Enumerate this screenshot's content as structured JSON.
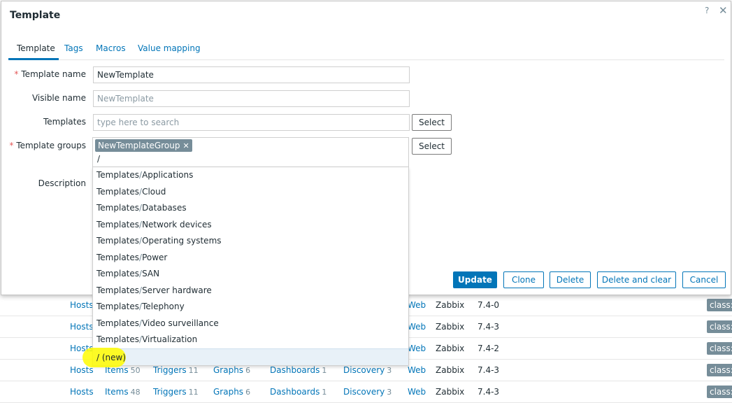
{
  "background_rows": [
    {
      "hosts": "Hosts",
      "items": "",
      "items_count": "",
      "triggers": "",
      "triggers_count": "",
      "graphs": "",
      "graphs_count": "",
      "dashboards": "",
      "dashboards_count": "",
      "discovery": "",
      "discovery_count": "",
      "web": "Web",
      "vendor": "Zabbix",
      "version": "7.4-0",
      "tag": "class:"
    },
    {
      "hosts": "Hosts",
      "items": "",
      "items_count": "",
      "triggers": "",
      "triggers_count": "",
      "graphs": "",
      "graphs_count": "",
      "dashboards": "",
      "dashboards_count": "",
      "discovery": "",
      "discovery_count": "",
      "web": "Web",
      "vendor": "Zabbix",
      "version": "7.4-3",
      "tag": "class:"
    },
    {
      "hosts": "Hosts",
      "items": "",
      "items_count": "",
      "triggers": "",
      "triggers_count": "",
      "graphs": "",
      "graphs_count": "",
      "dashboards": "",
      "dashboards_count": "",
      "discovery": "",
      "discovery_count": "",
      "web": "Web",
      "vendor": "Zabbix",
      "version": "7.4-2",
      "tag": "class:"
    },
    {
      "hosts": "Hosts",
      "items": "Items",
      "items_count": "50",
      "triggers": "Triggers",
      "triggers_count": "11",
      "graphs": "Graphs",
      "graphs_count": "6",
      "dashboards": "Dashboards",
      "dashboards_count": "1",
      "discovery": "Discovery",
      "discovery_count": "3",
      "web": "Web",
      "vendor": "Zabbix",
      "version": "7.4-3",
      "tag": "class:"
    },
    {
      "hosts": "Hosts",
      "items": "Items",
      "items_count": "48",
      "triggers": "Triggers",
      "triggers_count": "11",
      "graphs": "Graphs",
      "graphs_count": "6",
      "dashboards": "Dashboards",
      "dashboards_count": "1",
      "discovery": "Discovery",
      "discovery_count": "3",
      "web": "Web",
      "vendor": "Zabbix",
      "version": "7.4-3",
      "tag": "class:"
    }
  ],
  "modal": {
    "title": "Template",
    "help_icon": "?",
    "close_icon": "✕",
    "tabs": [
      "Template",
      "Tags",
      "Macros",
      "Value mapping"
    ],
    "form": {
      "template_name_label": "Template name",
      "template_name_value": "NewTemplate",
      "visible_name_label": "Visible name",
      "visible_name_placeholder": "NewTemplate",
      "templates_label": "Templates",
      "templates_placeholder": "type here to search",
      "select_label": "Select",
      "template_groups_label": "Template groups",
      "group_chip": "NewTemplateGroup",
      "chip_remove": "✕",
      "typed_value": "/",
      "description_label": "Description",
      "required_mark": "*"
    },
    "dropdown": {
      "items": [
        {
          "group": "Templates",
          "sep": "/",
          "name": "Applications"
        },
        {
          "group": "Templates",
          "sep": "/",
          "name": "Cloud"
        },
        {
          "group": "Templates",
          "sep": "/",
          "name": "Databases"
        },
        {
          "group": "Templates",
          "sep": "/",
          "name": "Network devices"
        },
        {
          "group": "Templates",
          "sep": "/",
          "name": "Operating systems"
        },
        {
          "group": "Templates",
          "sep": "/",
          "name": "Power"
        },
        {
          "group": "Templates",
          "sep": "/",
          "name": "SAN"
        },
        {
          "group": "Templates",
          "sep": "/",
          "name": "Server hardware"
        },
        {
          "group": "Templates",
          "sep": "/",
          "name": "Telephony"
        },
        {
          "group": "Templates",
          "sep": "/",
          "name": "Video surveillance"
        },
        {
          "group": "Templates",
          "sep": "/",
          "name": "Virtualization"
        }
      ],
      "new_item": "/ (new)"
    },
    "footer": {
      "update": "Update",
      "clone": "Clone",
      "delete": "Delete",
      "delete_and_clear": "Delete and clear",
      "cancel": "Cancel"
    }
  },
  "colors": {
    "accent": "#0275b8",
    "required": "#e45959",
    "chip": "#768d99",
    "highlight": "#fffb00"
  }
}
